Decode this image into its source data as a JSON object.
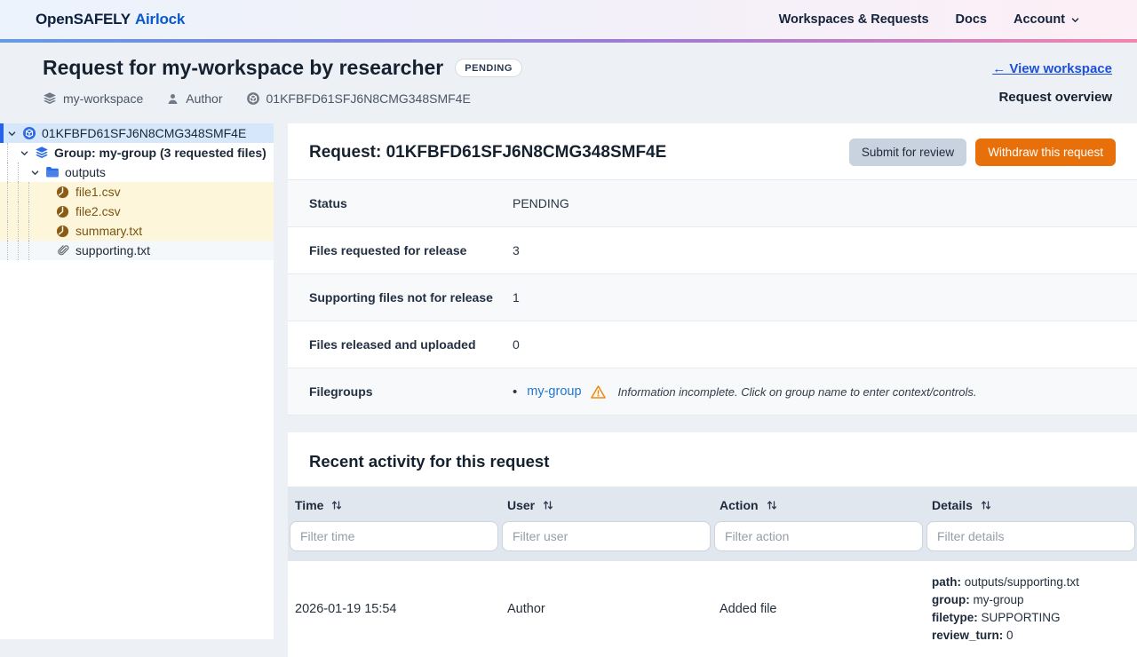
{
  "navbar": {
    "logo_primary": "OpenSAFELY",
    "logo_secondary": "Airlock",
    "links": [
      {
        "label": "Workspaces & Requests"
      },
      {
        "label": "Docs"
      },
      {
        "label": "Account",
        "icon": "chevron-down-icon"
      }
    ]
  },
  "header": {
    "title": "Request for my-workspace by researcher",
    "status_badge": "PENDING",
    "workspace": "my-workspace",
    "workspace_icon": "stack-icon",
    "author": "Author",
    "author_icon": "person-icon",
    "request_id": "01KFBFD61SFJ6N8CMG348SMF4E",
    "request_id_icon": "cube-icon",
    "back_link": "← View workspace",
    "overview_label": "Request overview"
  },
  "sidebar": {
    "tree": [
      {
        "label": "01KFBFD61SFJ6N8CMG348SMF4E",
        "icon": "request-cube-icon",
        "selected": true
      },
      {
        "label": "Group: my-group (3 requested files)",
        "icon": "stack-icon"
      },
      {
        "label": "outputs",
        "icon": "folder-icon"
      },
      {
        "label": "file1.csv",
        "icon": "output-file-icon",
        "highlight": "requested"
      },
      {
        "label": "file2.csv",
        "icon": "output-file-icon",
        "highlight": "requested"
      },
      {
        "label": "summary.txt",
        "icon": "output-file-icon",
        "highlight": "requested"
      },
      {
        "label": "supporting.txt",
        "icon": "paperclip-icon",
        "highlight": "supporting"
      }
    ]
  },
  "main": {
    "request_heading": "Request: 01KFBFD61SFJ6N8CMG348SMF4E",
    "buttons": {
      "submit": "Submit for review",
      "withdraw": "Withdraw this request"
    },
    "summary_rows": [
      {
        "label": "Status",
        "value": "PENDING"
      },
      {
        "label": "Files requested for release",
        "value": "3"
      },
      {
        "label": "Supporting files not for release",
        "value": "1"
      },
      {
        "label": "Files released and uploaded",
        "value": "0"
      }
    ],
    "filegroups": {
      "label": "Filegroups",
      "group_link": "my-group",
      "warning_icon": "warning-triangle-icon",
      "warning_text": "Information incomplete. Click on group name to enter context/controls."
    },
    "activity": {
      "heading": "Recent activity for this request",
      "columns": [
        {
          "label": "Time",
          "filter_placeholder": "Filter time"
        },
        {
          "label": "User",
          "filter_placeholder": "Filter user"
        },
        {
          "label": "Action",
          "filter_placeholder": "Filter action"
        },
        {
          "label": "Details",
          "filter_placeholder": "Filter details"
        }
      ],
      "rows": [
        {
          "time": "2026-01-19 15:54",
          "user": "Author",
          "action": "Added file",
          "details": [
            {
              "key": "path:",
              "value": "outputs/supporting.txt"
            },
            {
              "key": "group:",
              "value": "my-group"
            },
            {
              "key": "filetype:",
              "value": "SUPPORTING"
            },
            {
              "key": "review_turn:",
              "value": "0"
            }
          ]
        }
      ]
    }
  },
  "colors": {
    "brand_blue": "#0a58d0",
    "accent_gradient": [
      "#649ce2",
      "#a77bd0",
      "#f186ae"
    ],
    "selected_row_blue": "#d7e7fb",
    "requested_file_highlight": "#fdf6db",
    "requested_file_text": "#7a5410",
    "link_blue": "#2276d2",
    "warning_orange": "#ee8b0e",
    "withdraw_button_orange": "#e8700a",
    "secondary_button_gray": "#c9d3df"
  }
}
